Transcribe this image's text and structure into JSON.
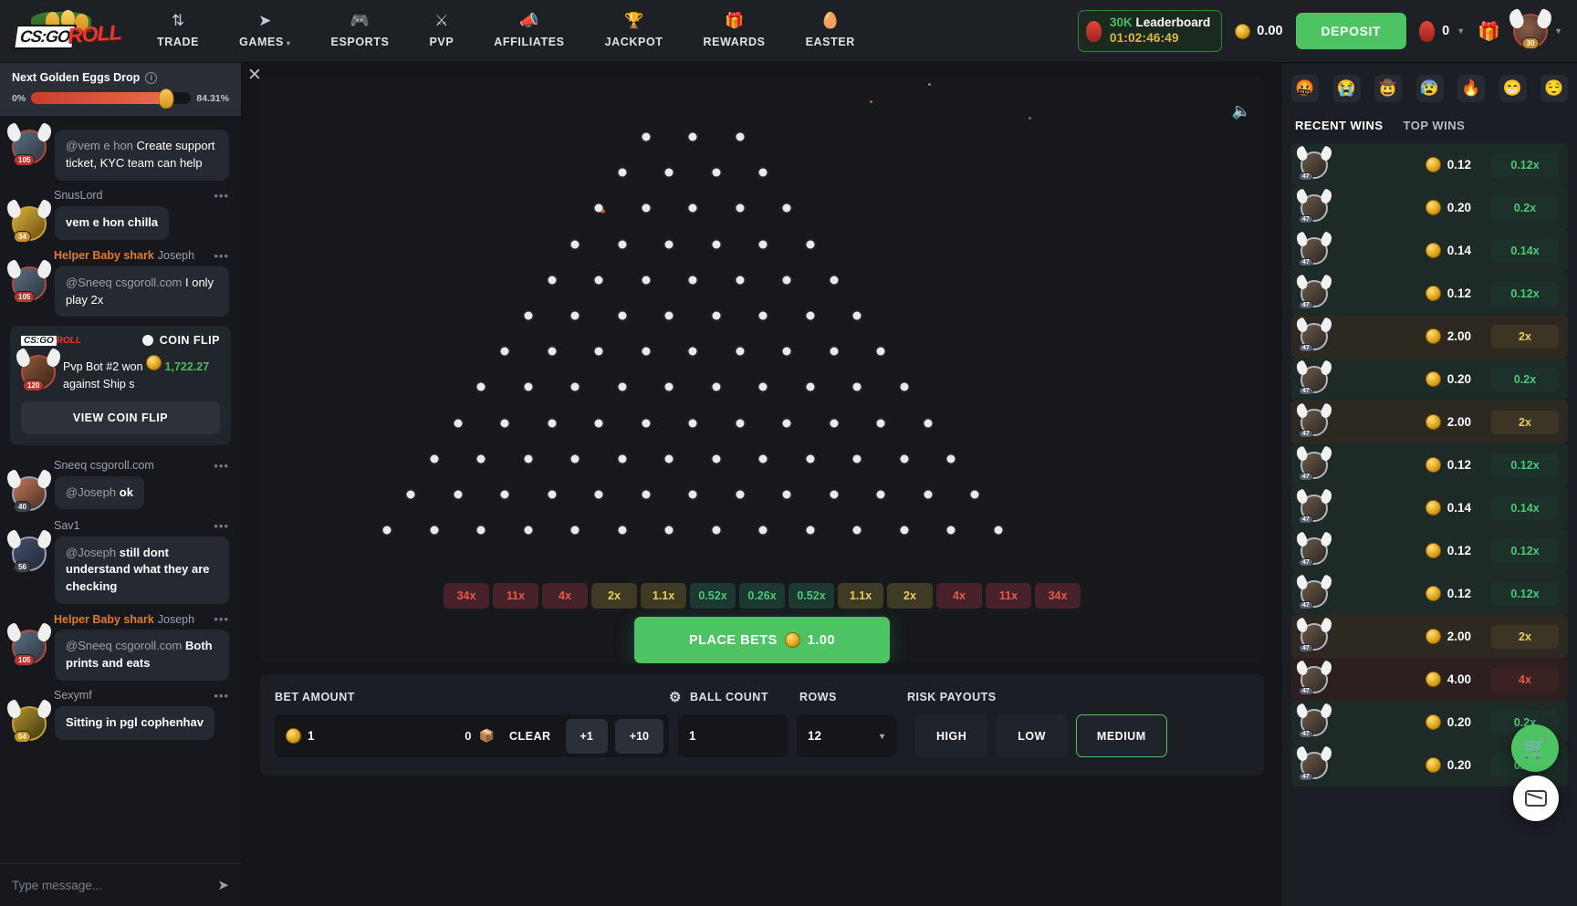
{
  "header": {
    "logo": {
      "csgo": "CS:GO",
      "roll": "ROLL"
    },
    "nav": [
      {
        "label": "TRADE",
        "icon": "trade-arrows-icon",
        "glyph": "⇅"
      },
      {
        "label": "GAMES",
        "icon": "rocket-icon",
        "glyph": "➤",
        "caret": "▾"
      },
      {
        "label": "ESPORTS",
        "icon": "gamepad-icon",
        "glyph": "🎮"
      },
      {
        "label": "PVP",
        "icon": "swords-icon",
        "glyph": "⚔"
      },
      {
        "label": "AFFILIATES",
        "icon": "megaphone-icon",
        "glyph": "📣"
      },
      {
        "label": "JACKPOT",
        "icon": "trophy-icon",
        "glyph": "🏆"
      },
      {
        "label": "REWARDS",
        "icon": "gift-icon",
        "glyph": "🎁"
      },
      {
        "label": "EASTER",
        "icon": "easter-egg-icon",
        "glyph": "🥚"
      }
    ],
    "leaderboard": {
      "amount": "30K",
      "label": "Leaderboard",
      "timer": "01:02:46:49"
    },
    "balance": "0.00",
    "deposit_label": "DEPOSIT",
    "egg_count": "0",
    "gift_icon": "gift-box-icon",
    "user_level": "30"
  },
  "chat": {
    "drop": {
      "title": "Next Golden Eggs Drop",
      "min_label": "0%",
      "max_label": "84.31%",
      "progress": 84.31
    },
    "messages": [
      {
        "name": "",
        "helper": "",
        "mention": "@vem e hon",
        "text": "Create support ticket, KYC team can help",
        "level": "105",
        "avatar": "g1"
      },
      {
        "name": "SnusLord",
        "helper": "",
        "mention": "",
        "text": "vem e hon chilla",
        "level": "34",
        "avatar": "g2"
      },
      {
        "name": "Joseph",
        "helper": "Helper Baby shark",
        "mention": "@Sneeq csgoroll.com",
        "text": "I only play 2x",
        "level": "105",
        "avatar": "g1"
      }
    ],
    "coinflip": {
      "title": "COIN FLIP",
      "logo_a": "CS:GO",
      "logo_b": "ROLL",
      "text_pre": "Pvp Bot #2 won",
      "amount": "1,722.27",
      "text_post": "against Ship s",
      "button": "VIEW COIN FLIP",
      "level": "120"
    },
    "messages2": [
      {
        "name": "Sneeq csgoroll.com",
        "helper": "",
        "mention": "@Joseph",
        "text": "ok",
        "level": "40",
        "avatar": "g4"
      },
      {
        "name": "Sav1",
        "helper": "",
        "mention": "@Joseph",
        "text": "still dont understand what they are checking",
        "level": "56",
        "avatar": "g5"
      },
      {
        "name": "Joseph",
        "helper": "Helper Baby shark",
        "mention": "@Sneeq csgoroll.com",
        "text": "Both prints and eats",
        "level": "105",
        "avatar": "g1"
      },
      {
        "name": "Sexymf",
        "helper": "",
        "mention": "",
        "text": "Sitting in pgl cophenhav",
        "level": "04",
        "avatar": "g6"
      }
    ],
    "input_placeholder": "Type message...",
    "send_icon": "send-arrow-icon",
    "menu_dots": "•••"
  },
  "game": {
    "close_icon": "close-icon",
    "sound_icon": "speaker-on-icon",
    "multipliers": [
      {
        "value": "34x",
        "tone": "red"
      },
      {
        "value": "11x",
        "tone": "red"
      },
      {
        "value": "4x",
        "tone": "red"
      },
      {
        "value": "2x",
        "tone": "yel"
      },
      {
        "value": "1.1x",
        "tone": "yel"
      },
      {
        "value": "0.52x",
        "tone": "grn"
      },
      {
        "value": "0.26x",
        "tone": "grn"
      },
      {
        "value": "0.52x",
        "tone": "grn"
      },
      {
        "value": "1.1x",
        "tone": "yel"
      },
      {
        "value": "2x",
        "tone": "yel"
      },
      {
        "value": "4x",
        "tone": "red"
      },
      {
        "value": "11x",
        "tone": "red"
      },
      {
        "value": "34x",
        "tone": "red"
      }
    ],
    "place_bets_label": "PLACE BETS",
    "place_bets_amount": "1.00",
    "rows_count": 12
  },
  "controls": {
    "bet_amount_label": "BET AMOUNT",
    "settings_icon": "gear-icon",
    "ball_count_label": "BALL COUNT",
    "rows_label": "ROWS",
    "risk_label": "RISK PAYOUTS",
    "bet_value": "1",
    "items_count": "0",
    "case_icon": "case-icon",
    "clear_label": "CLEAR",
    "plus1_label": "+1",
    "plus10_label": "+10",
    "ball_count_value": "1",
    "rows_value": "12",
    "risk_options": [
      "HIGH",
      "LOW",
      "MEDIUM"
    ],
    "risk_selected": "MEDIUM"
  },
  "right_panel": {
    "emojis": [
      "🤬",
      "😭",
      "🤠",
      "😰",
      "🔥",
      "😁",
      "😌"
    ],
    "tabs": [
      {
        "label": "RECENT WINS",
        "active": true
      },
      {
        "label": "TOP WINS",
        "active": false
      }
    ],
    "wins": [
      {
        "amount": "0.12",
        "mult": "0.12x",
        "tone": "green",
        "level": "47"
      },
      {
        "amount": "0.20",
        "mult": "0.2x",
        "tone": "green",
        "level": "47"
      },
      {
        "amount": "0.14",
        "mult": "0.14x",
        "tone": "green",
        "level": "47"
      },
      {
        "amount": "0.12",
        "mult": "0.12x",
        "tone": "green",
        "level": "47"
      },
      {
        "amount": "2.00",
        "mult": "2x",
        "tone": "gold",
        "level": "47"
      },
      {
        "amount": "0.20",
        "mult": "0.2x",
        "tone": "green",
        "level": "47"
      },
      {
        "amount": "2.00",
        "mult": "2x",
        "tone": "gold",
        "level": "47"
      },
      {
        "amount": "0.12",
        "mult": "0.12x",
        "tone": "green",
        "level": "47"
      },
      {
        "amount": "0.14",
        "mult": "0.14x",
        "tone": "green",
        "level": "47"
      },
      {
        "amount": "0.12",
        "mult": "0.12x",
        "tone": "green",
        "level": "47"
      },
      {
        "amount": "0.12",
        "mult": "0.12x",
        "tone": "green",
        "level": "47"
      },
      {
        "amount": "2.00",
        "mult": "2x",
        "tone": "gold",
        "level": "47"
      },
      {
        "amount": "4.00",
        "mult": "4x",
        "tone": "red",
        "level": "47"
      },
      {
        "amount": "0.20",
        "mult": "0.2x",
        "tone": "green",
        "level": "47"
      },
      {
        "amount": "0.20",
        "mult": "0.2x",
        "tone": "green",
        "level": "47"
      }
    ],
    "cart_icon": "shopping-cart-icon",
    "support_icon": "support-chat-icon"
  },
  "colors": {
    "accent_green": "#4dc364",
    "accent_red": "#e0392c",
    "gold": "#e0b544",
    "bg_dark": "#131519",
    "panel": "#1b1e24"
  }
}
